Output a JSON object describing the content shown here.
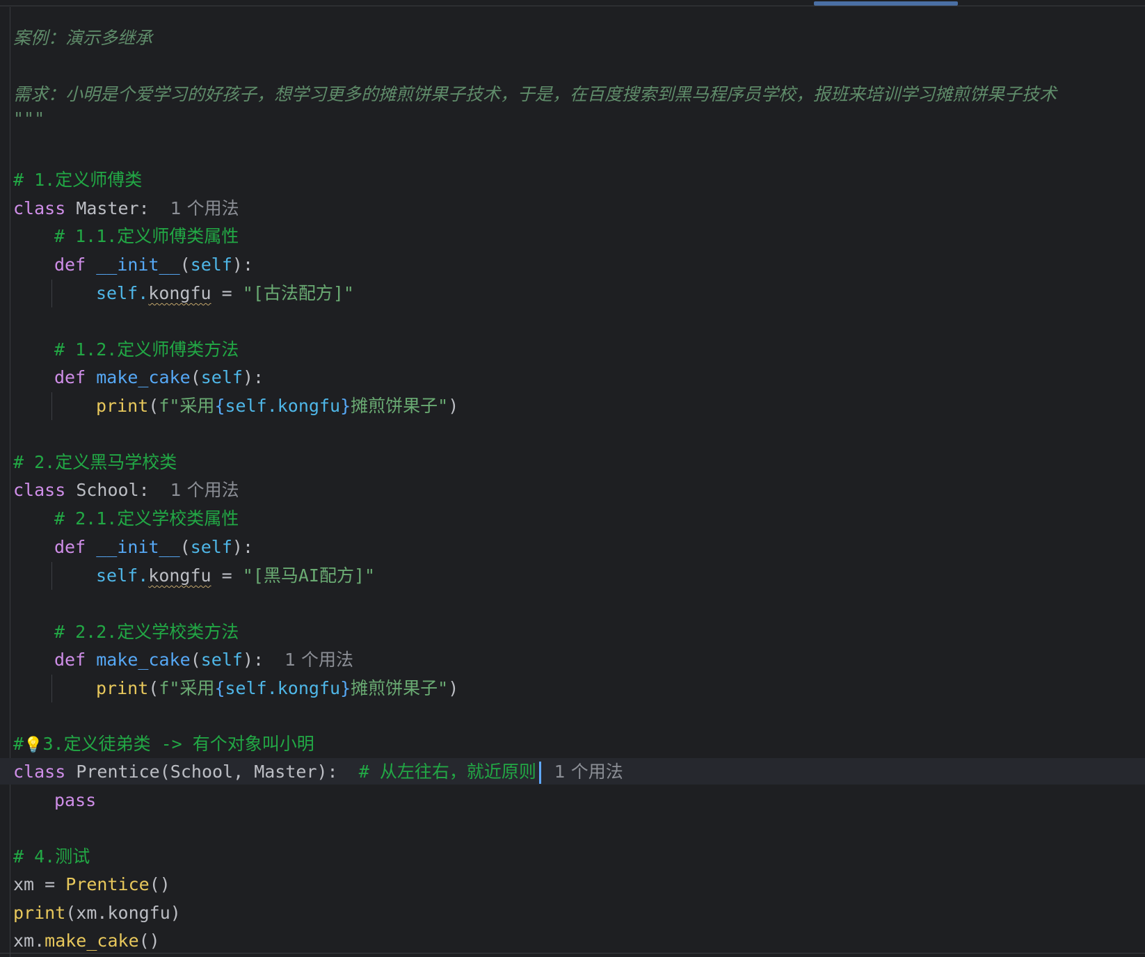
{
  "editor": {
    "docstring_open_fragment": "\"\"\"",
    "docstring_case": "案例：演示多继承",
    "docstring_requirement": "需求：小明是个爱学习的好孩子，想学习更多的摊煎饼果子技术，于是，在百度搜索到黑马程序员学校，报班来培训学习摊煎饼果子技术",
    "docstring_close": "\"\"\"",
    "usage_hint": "1 个用法",
    "comment_1": "# 1.定义师傅类",
    "class_kw": "class",
    "def_kw": "def",
    "pass_kw": "pass",
    "master_class_name": "Master",
    "colon": ":",
    "comment_1_1": "# 1.1.定义师傅类属性",
    "init_name": "__init__",
    "self_param": "self",
    "paren_open": "(",
    "paren_close_colon": "):",
    "self_dot": "self.",
    "kongfu_attr": "kongfu",
    "assign_op": " = ",
    "master_kongfu_value": "\"[古法配方]\"",
    "comment_1_2": "# 1.2.定义师傅类方法",
    "make_cake_name": "make_cake",
    "print_name": "print",
    "fstring_prefix": "f\"采用",
    "fstring_brace_open": "{",
    "fstring_expr": "self.kongfu",
    "fstring_brace_close": "}",
    "fstring_suffix": "摊煎饼果子\"",
    "close_paren": ")",
    "comment_2": "# 2.定义黑马学校类",
    "school_class_name": "School",
    "comment_2_1": "# 2.1.定义学校类属性",
    "school_kongfu_value": "\"[黑马AI配方]\"",
    "comment_2_2": "# 2.2.定义学校类方法",
    "comment_3_hash": "#",
    "comment_3_text": "3.定义徒弟类 -> 有个对象叫小明",
    "prentice_class_signature": "Prentice(School, Master):",
    "prentice_inline_comment": "# 从左往右，就近原则",
    "comment_4": "# 4.测试",
    "xm_assign": "xm = ",
    "prentice_call": "Prentice",
    "empty_call": "()",
    "print_arg": "(xm.kongfu)",
    "xm_dot": "xm.",
    "bulb_icon": "lightbulb-icon"
  }
}
